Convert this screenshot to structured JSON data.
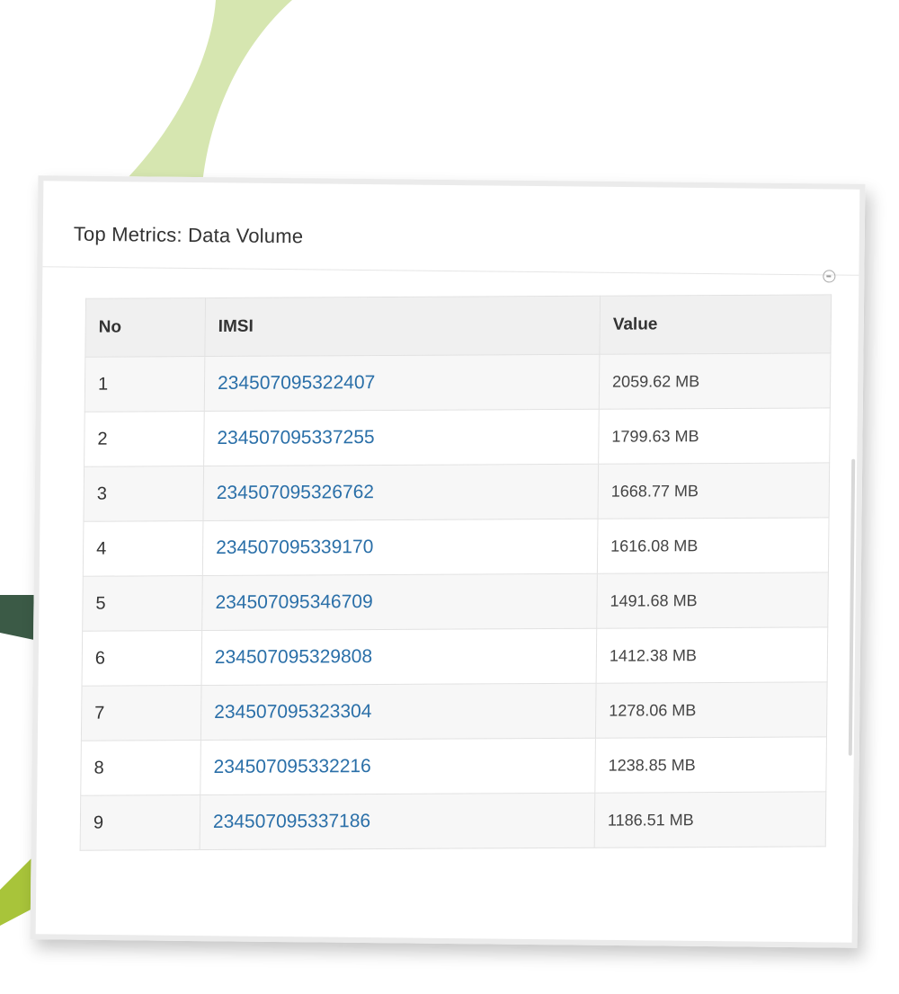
{
  "panel": {
    "title": "Top Metrics: Data Volume",
    "collapse_icon": "collapse-circle-icon"
  },
  "table": {
    "headers": {
      "no": "No",
      "imsi": "IMSI",
      "value": "Value"
    },
    "rows": [
      {
        "no": "1",
        "imsi": "234507095322407",
        "value": "2059.62 MB"
      },
      {
        "no": "2",
        "imsi": "234507095337255",
        "value": "1799.63 MB"
      },
      {
        "no": "3",
        "imsi": "234507095326762",
        "value": "1668.77 MB"
      },
      {
        "no": "4",
        "imsi": "234507095339170",
        "value": "1616.08 MB"
      },
      {
        "no": "5",
        "imsi": "234507095346709",
        "value": "1491.68 MB"
      },
      {
        "no": "6",
        "imsi": "234507095329808",
        "value": "1412.38 MB"
      },
      {
        "no": "7",
        "imsi": "234507095323304",
        "value": "1278.06 MB"
      },
      {
        "no": "8",
        "imsi": "234507095332216",
        "value": "1238.85 MB"
      },
      {
        "no": "9",
        "imsi": "234507095337186",
        "value": "1186.51 MB"
      }
    ]
  },
  "colors": {
    "link": "#2a6fa8",
    "decor_light_green": "#d6e6b0",
    "decor_dark_green": "#3b5a46",
    "decor_lime": "#a8c43a"
  }
}
